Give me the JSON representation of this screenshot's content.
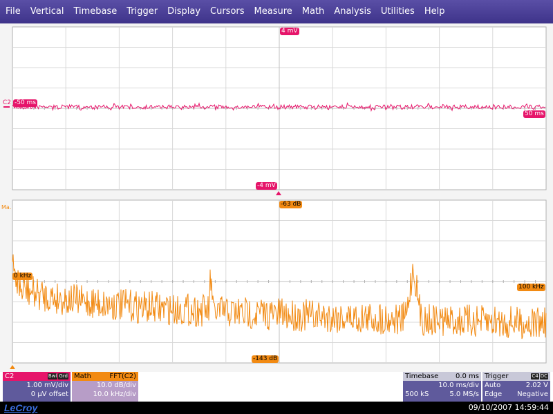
{
  "menu": [
    "File",
    "Vertical",
    "Timebase",
    "Trigger",
    "Display",
    "Cursors",
    "Measure",
    "Math",
    "Analysis",
    "Utilities",
    "Help"
  ],
  "colors": {
    "c2": "#e6156a",
    "math": "#f28a12",
    "menubar": "#3e338a",
    "panel": "#5f5a9c"
  },
  "grid1": {
    "top_label": "4 mV",
    "bottom_label": "-4 mV",
    "left_label": "-50 ms",
    "right_label": "50 ms",
    "channel_label": "C2"
  },
  "grid2": {
    "top_label": "-63 dB",
    "bottom_label": "-143 dB",
    "left_label": "0 kHz",
    "right_label": "100 kHz",
    "channel_label": "Ma."
  },
  "c2_descriptor": {
    "name": "C2",
    "badges": [
      "Bwl",
      "Grd"
    ],
    "vdiv": "1.00 mV/div",
    "offset": "0 μV offset"
  },
  "math_descriptor": {
    "name": "Math",
    "function": "FFT(C2)",
    "vdiv": "10.0 dB/div",
    "hdiv": "10.0 kHz/div"
  },
  "timebase": {
    "title": "Timebase",
    "delay": "0.0 ms",
    "tdiv": "10.0 ms/div",
    "samples": "500 kS",
    "rate": "5.0 MS/s"
  },
  "trigger": {
    "title": "Trigger",
    "badges": [
      "C4",
      "DC"
    ],
    "mode": "Auto",
    "level": "2.02 V",
    "type": "Edge",
    "slope": "Negative"
  },
  "status": {
    "brand": "LeCroy",
    "datetime": "09/10/2007 14:59:44"
  }
}
